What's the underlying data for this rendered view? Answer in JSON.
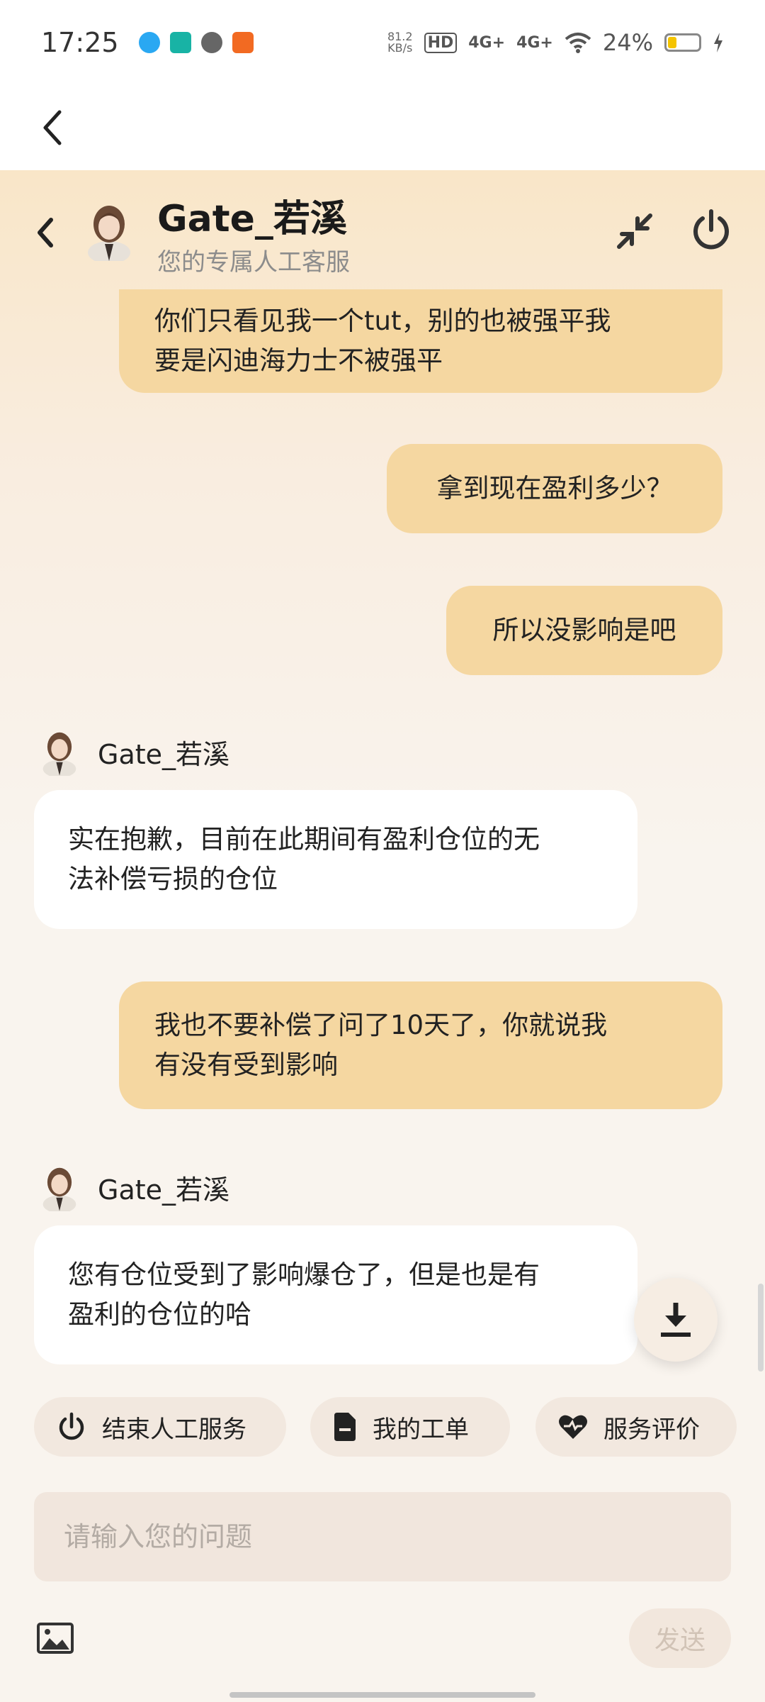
{
  "status_bar": {
    "time": "17:25",
    "net_speed_value": "81.2",
    "net_speed_unit": "KB/s",
    "hd_label": "HD",
    "signal1": "4G+",
    "signal2": "4G+",
    "battery_percent": "24%",
    "battery_level": 0.24,
    "app_icons": [
      "qq-icon",
      "boss-zhipin-icon",
      "message-icon",
      "app-icon"
    ]
  },
  "header": {
    "title": "Gate_若溪",
    "subtitle": "您的专属人工客服"
  },
  "messages": [
    {
      "from": "me",
      "text_line1": "你们只看见我一个tut，别的也被强平我",
      "text_line2": "要是闪迪海力士不被强平"
    },
    {
      "from": "me",
      "text": "拿到现在盈利多少？"
    },
    {
      "from": "me",
      "text": "所以没影响是吧"
    },
    {
      "from": "agent",
      "name": "Gate_若溪",
      "text_line1": "实在抱歉，目前在此期间有盈利仓位的无",
      "text_line2": "法补偿亏损的仓位"
    },
    {
      "from": "me",
      "text_line1": "我也不要补偿了问了10天了，你就说我",
      "text_line2": "有没有受到影响"
    },
    {
      "from": "agent",
      "name": "Gate_若溪",
      "text_line1": "您有仓位受到了影响爆仓了，但是也是有",
      "text_line2": "盈利的仓位的哈"
    }
  ],
  "quick_actions": {
    "end_service": "结束人工服务",
    "my_tickets": "我的工单",
    "rate_service": "服务评价"
  },
  "input": {
    "placeholder": "请输入您的问题",
    "value": ""
  },
  "send_label": "发送",
  "colors": {
    "my_bubble": "#f5d7a1",
    "agent_bubble": "#ffffff",
    "header_gradient_top": "#f9e6c8",
    "page_bg": "#f9f4ee"
  }
}
